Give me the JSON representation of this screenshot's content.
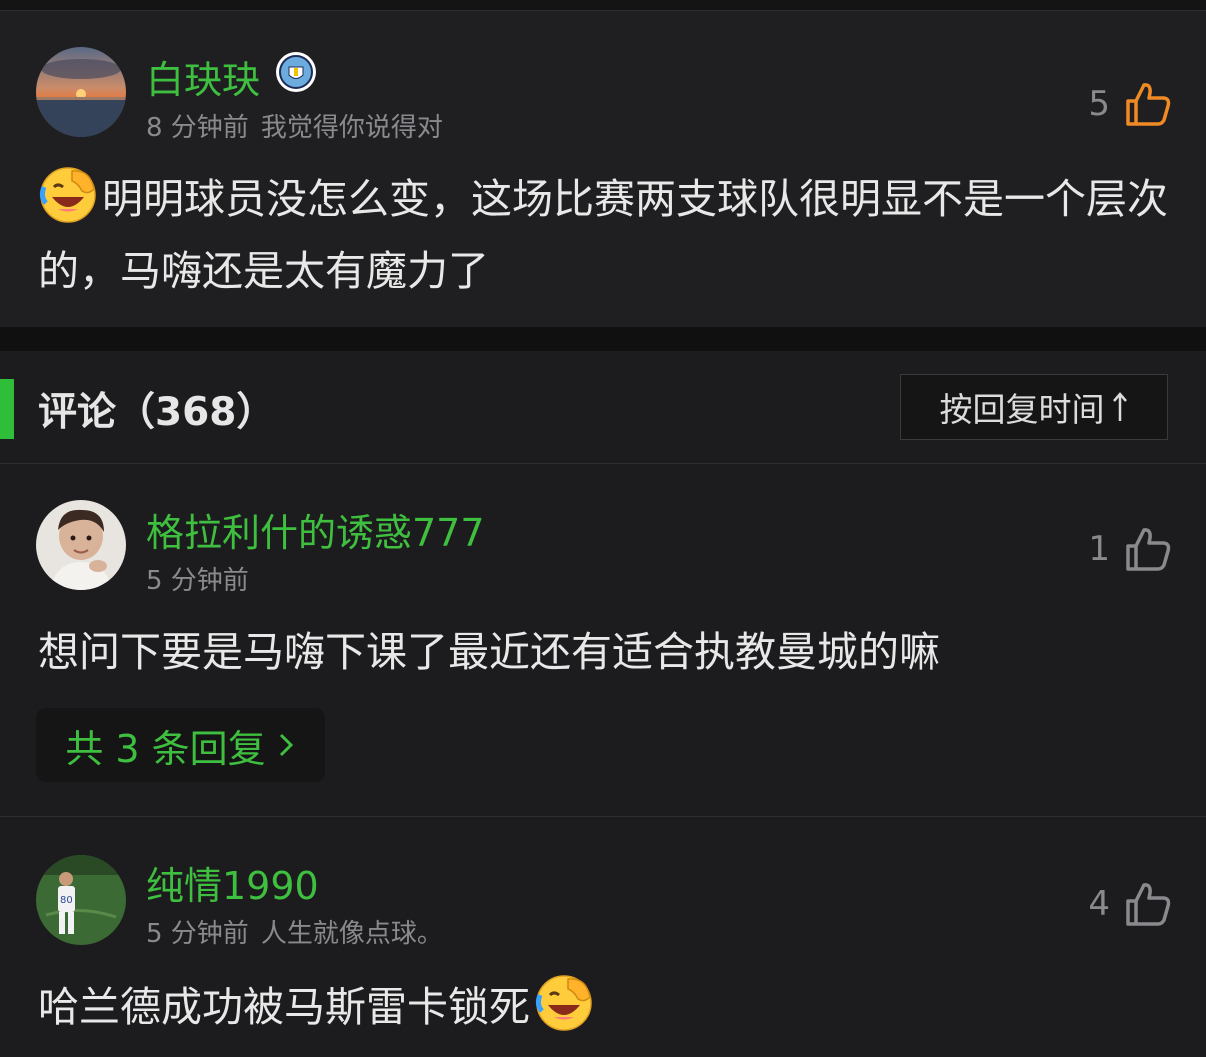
{
  "post": {
    "username": "白玦玦",
    "time": "8 分钟前",
    "signature": "我觉得你说得对",
    "likes": "5",
    "text": "明明球员没怎么变，这场比赛两支球队很明显不是一个层次的，马嗨还是太有魔力了",
    "emoji": "facepalm-laugh-emoji",
    "badge": "club-crest-icon"
  },
  "comments_header": {
    "title": "评论（368）",
    "sort_label": "按回复时间",
    "sort_icon": "arrow-up-icon"
  },
  "comments": [
    {
      "username": "格拉利什的诱惑777",
      "time": "5 分钟前",
      "signature": "",
      "likes": "1",
      "text": "想问下要是马嗨下课了最近还有适合执教曼城的嘛",
      "replies_label": "共 3 条回复",
      "replies_icon": "chevron-right-icon"
    },
    {
      "username": "纯情1990",
      "time": "5 分钟前",
      "signature": "人生就像点球。",
      "likes": "4",
      "text": "哈兰德成功被马斯雷卡锁死",
      "emoji": "facepalm-laugh-emoji"
    }
  ],
  "colors": {
    "username": "#3fbf3f",
    "accent": "#2fbe3a",
    "like_active": "#f08a24",
    "like_inactive": "#8a8a8e",
    "background": "#1c1c1e"
  }
}
